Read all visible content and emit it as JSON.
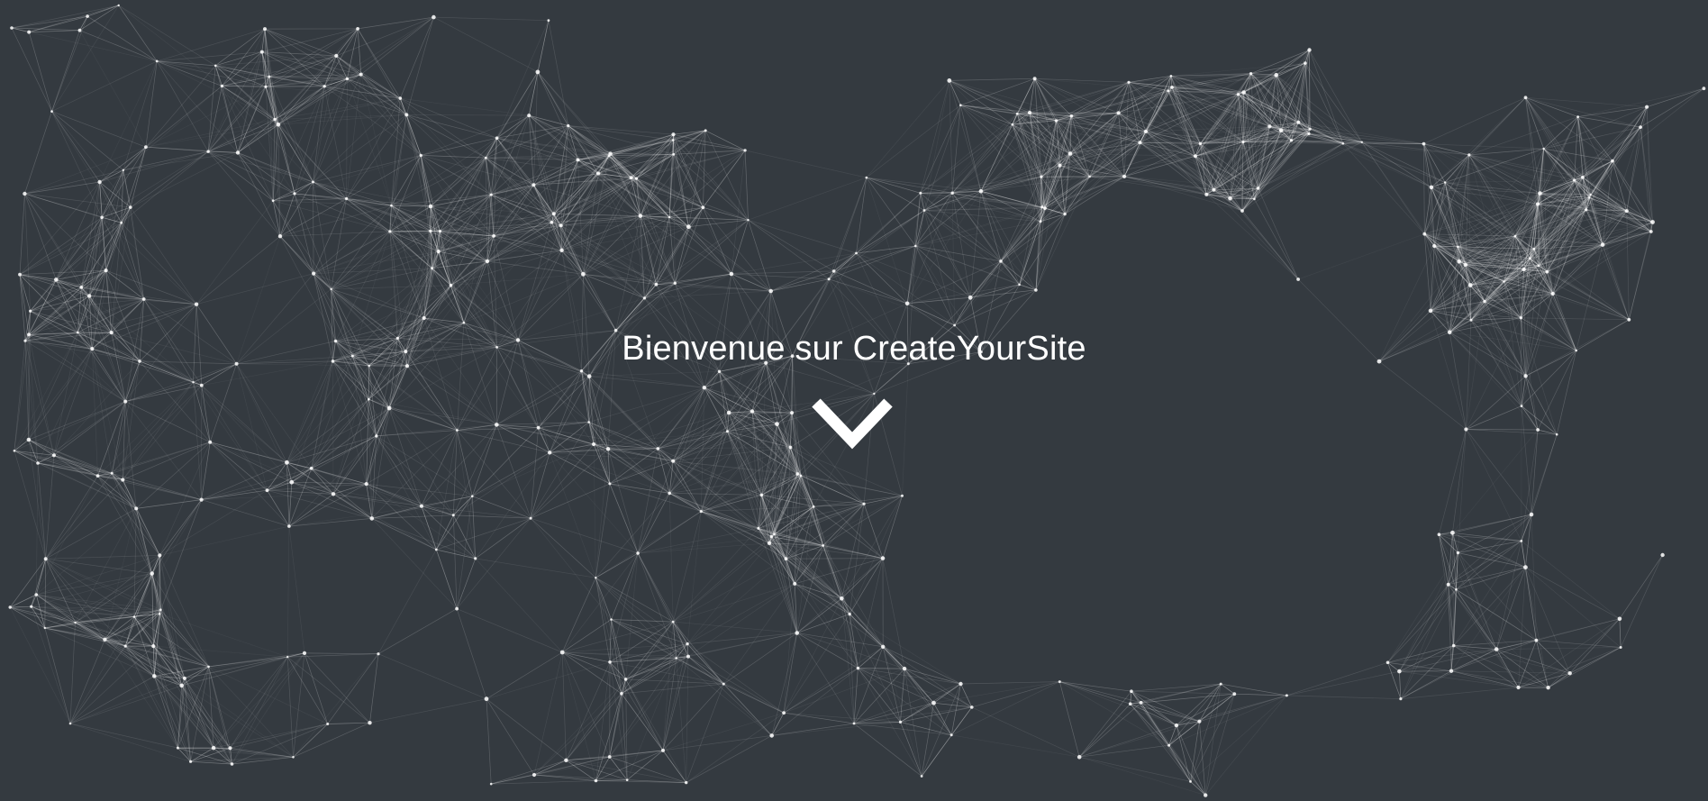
{
  "hero": {
    "title": "Bienvenue sur CreateYourSite",
    "scroll_icon": "chevron-down-icon"
  },
  "colors": {
    "background": "#343a40",
    "particles": "#ffffff",
    "text": "#ffffff"
  }
}
